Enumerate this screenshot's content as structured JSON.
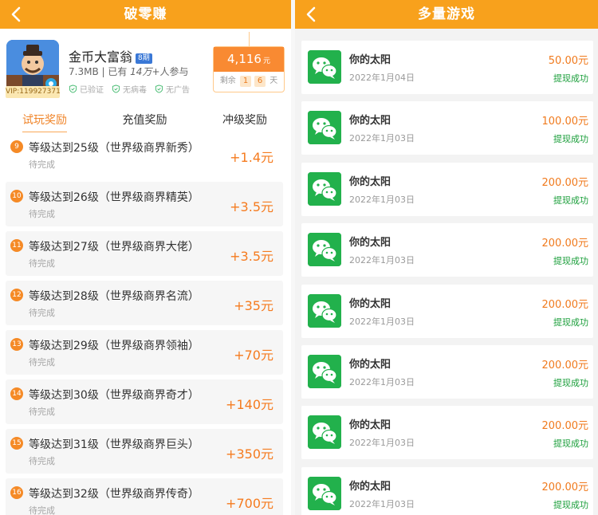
{
  "left": {
    "header_title": "破零赚",
    "app": {
      "name": "金币大富翁",
      "period_badge": "8期",
      "meta_prefix": "7.3MB | 已有 ",
      "meta_count": "14万+",
      "meta_suffix": "人参与",
      "vip_text": "VIP:119927371",
      "badges": [
        "已验证",
        "无病毒",
        "无广告"
      ]
    },
    "reward": {
      "amount": "4,116",
      "unit": "元",
      "remain_label": "剩余",
      "remain_d1": "1",
      "remain_d2": "6",
      "remain_unit": "天"
    },
    "tabs": [
      "试玩奖励",
      "充值奖励",
      "冲级奖励"
    ],
    "tasks": [
      {
        "num": "9",
        "name": "等级达到25级（世界级商界新秀）",
        "status": "待完成",
        "amount": "+1.4元"
      },
      {
        "num": "10",
        "name": "等级达到26级（世界级商界精英）",
        "status": "待完成",
        "amount": "+3.5元"
      },
      {
        "num": "11",
        "name": "等级达到27级（世界级商界大佬）",
        "status": "待完成",
        "amount": "+3.5元"
      },
      {
        "num": "12",
        "name": "等级达到28级（世界级商界名流）",
        "status": "待完成",
        "amount": "+35元"
      },
      {
        "num": "13",
        "name": "等级达到29级（世界级商界领袖）",
        "status": "待完成",
        "amount": "+70元"
      },
      {
        "num": "14",
        "name": "等级达到30级（世界级商界奇才）",
        "status": "待完成",
        "amount": "+140元"
      },
      {
        "num": "15",
        "name": "等级达到31级（世界级商界巨头）",
        "status": "待完成",
        "amount": "+350元"
      },
      {
        "num": "16",
        "name": "等级达到32级（世界级商界传奇）",
        "status": "待完成",
        "amount": "+700元"
      }
    ]
  },
  "right": {
    "header_title": "多量游戏",
    "records": [
      {
        "name": "你的太阳",
        "date": "2022年1月04日",
        "amount": "50.00元",
        "status": "提现成功"
      },
      {
        "name": "你的太阳",
        "date": "2022年1月03日",
        "amount": "100.00元",
        "status": "提现成功"
      },
      {
        "name": "你的太阳",
        "date": "2022年1月03日",
        "amount": "200.00元",
        "status": "提现成功"
      },
      {
        "name": "你的太阳",
        "date": "2022年1月03日",
        "amount": "200.00元",
        "status": "提现成功"
      },
      {
        "name": "你的太阳",
        "date": "2022年1月03日",
        "amount": "200.00元",
        "status": "提现成功"
      },
      {
        "name": "你的太阳",
        "date": "2022年1月03日",
        "amount": "200.00元",
        "status": "提现成功"
      },
      {
        "name": "你的太阳",
        "date": "2022年1月03日",
        "amount": "200.00元",
        "status": "提现成功"
      },
      {
        "name": "你的太阳",
        "date": "2022年1月03日",
        "amount": "200.00元",
        "status": "提现成功"
      }
    ]
  },
  "colors": {
    "header": "#f8a11c",
    "accent": "#f57b1f",
    "success": "#1a9e3a",
    "wechat": "#22b14c"
  },
  "icons": {
    "back": "chevron-left-icon",
    "verified": "shield-check-icon",
    "wechat": "wechat-icon"
  }
}
